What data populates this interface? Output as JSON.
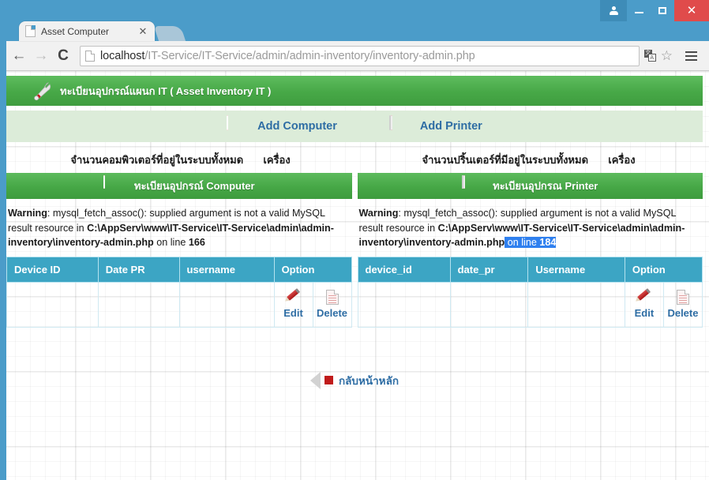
{
  "window": {
    "buttons": {
      "user": "user-account-icon",
      "minimize": "–",
      "maximize": "□",
      "close": "✕"
    }
  },
  "tab": {
    "title": "Asset Computer",
    "close": "✕"
  },
  "toolbar": {
    "back": "←",
    "forward": "→",
    "reload": "C",
    "star": "☆",
    "translate_sq1": "文",
    "translate_sq2": "A",
    "url_host": "localhost",
    "url_path": "/IT-Service/IT-Service/admin/admin-inventory/inventory-admin.php"
  },
  "page": {
    "header_title": "ทะเบียนอุปกรณ์แผนก IT ( Asset Inventory IT )",
    "actions": [
      {
        "label": "Add Computer",
        "icon": "monitor-icon"
      },
      {
        "label": "Add Printer",
        "icon": "printer-icon"
      }
    ],
    "counts": [
      {
        "text": "จำนวนคอมพิวเตอร์ที่อยู่ในระบบทั้งหมด",
        "unit": "เครื่อง"
      },
      {
        "text": "จำนวนปริ้นเตอร์ที่มีอยู่ในระบบทั้งหมด",
        "unit": "เครื่อง"
      }
    ],
    "panels": [
      {
        "head_title": "ทะเบียนอุปกรณ์ Computer",
        "head_icon": "monitor-icon",
        "warning": {
          "label": "Warning",
          "message": ": mysql_fetch_assoc(): supplied argument is not a valid MySQL result resource in ",
          "path": "C:\\AppServ\\www\\IT-Service\\IT-Service\\admin\\admin-inventory\\inventory-admin.php",
          "suffix": " on line ",
          "line": "166",
          "selected": false
        },
        "columns": [
          "Device ID",
          "Date PR",
          "username",
          "Option"
        ],
        "rows": [
          {
            "device_id": "",
            "date": "",
            "username": ""
          }
        ],
        "options": [
          {
            "label": "Edit",
            "icon": "pencil-icon"
          },
          {
            "label": "Delete",
            "icon": "document-icon"
          }
        ]
      },
      {
        "head_title": "ทะเบียนอุปกรณ Printer",
        "head_icon": "printer-icon",
        "warning": {
          "label": "Warning",
          "message": ": mysql_fetch_assoc(): supplied argument is not a valid MySQL result resource in ",
          "path": "C:\\AppServ\\www\\IT-Service\\IT-Service\\admin\\admin-inventory\\inventory-admin.php",
          "suffix": " on line ",
          "line": "184",
          "selected": true
        },
        "columns": [
          "device_id",
          "date_pr",
          "Username",
          "Option"
        ],
        "rows": [
          {
            "device_id": "",
            "date": "",
            "username": ""
          }
        ],
        "options": [
          {
            "label": "Edit",
            "icon": "pencil-icon"
          },
          {
            "label": "Delete",
            "icon": "document-icon"
          }
        ]
      }
    ],
    "back_link": "กลับหน้าหลัก"
  },
  "colors": {
    "chrome_blue": "#4b9cc9",
    "header_green": "#47a847",
    "table_header_teal": "#3ca5c4",
    "link_blue": "#2e6da4",
    "icon_red": "#c01b1b",
    "selection_blue": "#2f80ef",
    "add_row_green": "#dcecd9"
  }
}
